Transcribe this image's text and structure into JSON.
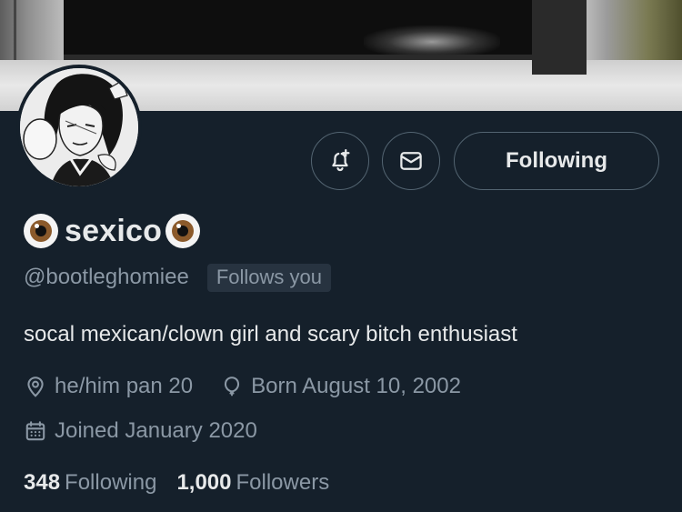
{
  "profile": {
    "display_name": "sexico",
    "name_emoji": "eyes-emoji",
    "handle": "@bootleghomiee",
    "follows_you_badge": "Follows you",
    "bio": "socal mexican/clown girl and scary bitch enthusiast",
    "pronouns": "he/him pan 20",
    "birthday": "Born August 10, 2002",
    "joined": "Joined January 2020"
  },
  "actions": {
    "notify_icon": "bell-plus-icon",
    "message_icon": "envelope-icon",
    "follow_label": "Following"
  },
  "stats": {
    "following_count": "348",
    "following_label": "Following",
    "followers_count": "1,000",
    "followers_label": "Followers"
  },
  "colors": {
    "background": "#15202b",
    "primary_text": "#e7e9ea",
    "secondary_text": "#8b98a5",
    "border": "#536471",
    "badge_bg": "#273340"
  }
}
